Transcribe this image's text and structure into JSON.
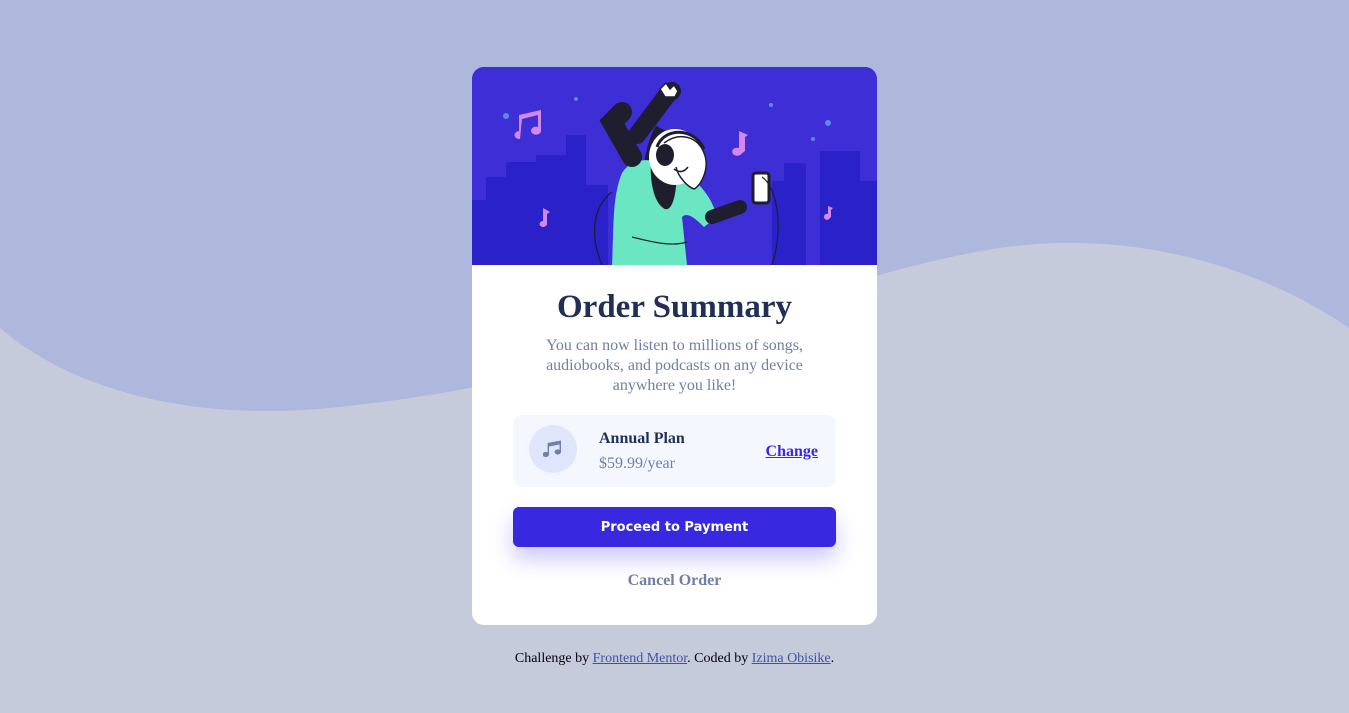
{
  "colors": {
    "page_background": "#c6cbdc",
    "wave": "#adb8dc",
    "hero_background": "#3d2ed6",
    "accent": "#3829e0",
    "title": "#1f2f56",
    "muted_text": "#717fa6"
  },
  "hero": {
    "image": "illustration-hero",
    "icon_names": [
      "music-note-icon",
      "woman-with-headphones-illustration",
      "city-skyline-illustration"
    ]
  },
  "card": {
    "title": "Order Summary",
    "description": "You can now listen to millions of songs, audiobooks, and podcasts on any device anywhere you like!",
    "plan": {
      "icon": "music-note-icon",
      "name": "Annual Plan",
      "price": "$59.99/year",
      "change_label": "Change"
    },
    "proceed_label": "Proceed to Payment",
    "cancel_label": "Cancel Order"
  },
  "footer": {
    "prefix": "Challenge by ",
    "mentor_link": "Frontend Mentor",
    "middle": ". Coded by ",
    "author_link": "Izima Obisike",
    "suffix": "."
  }
}
